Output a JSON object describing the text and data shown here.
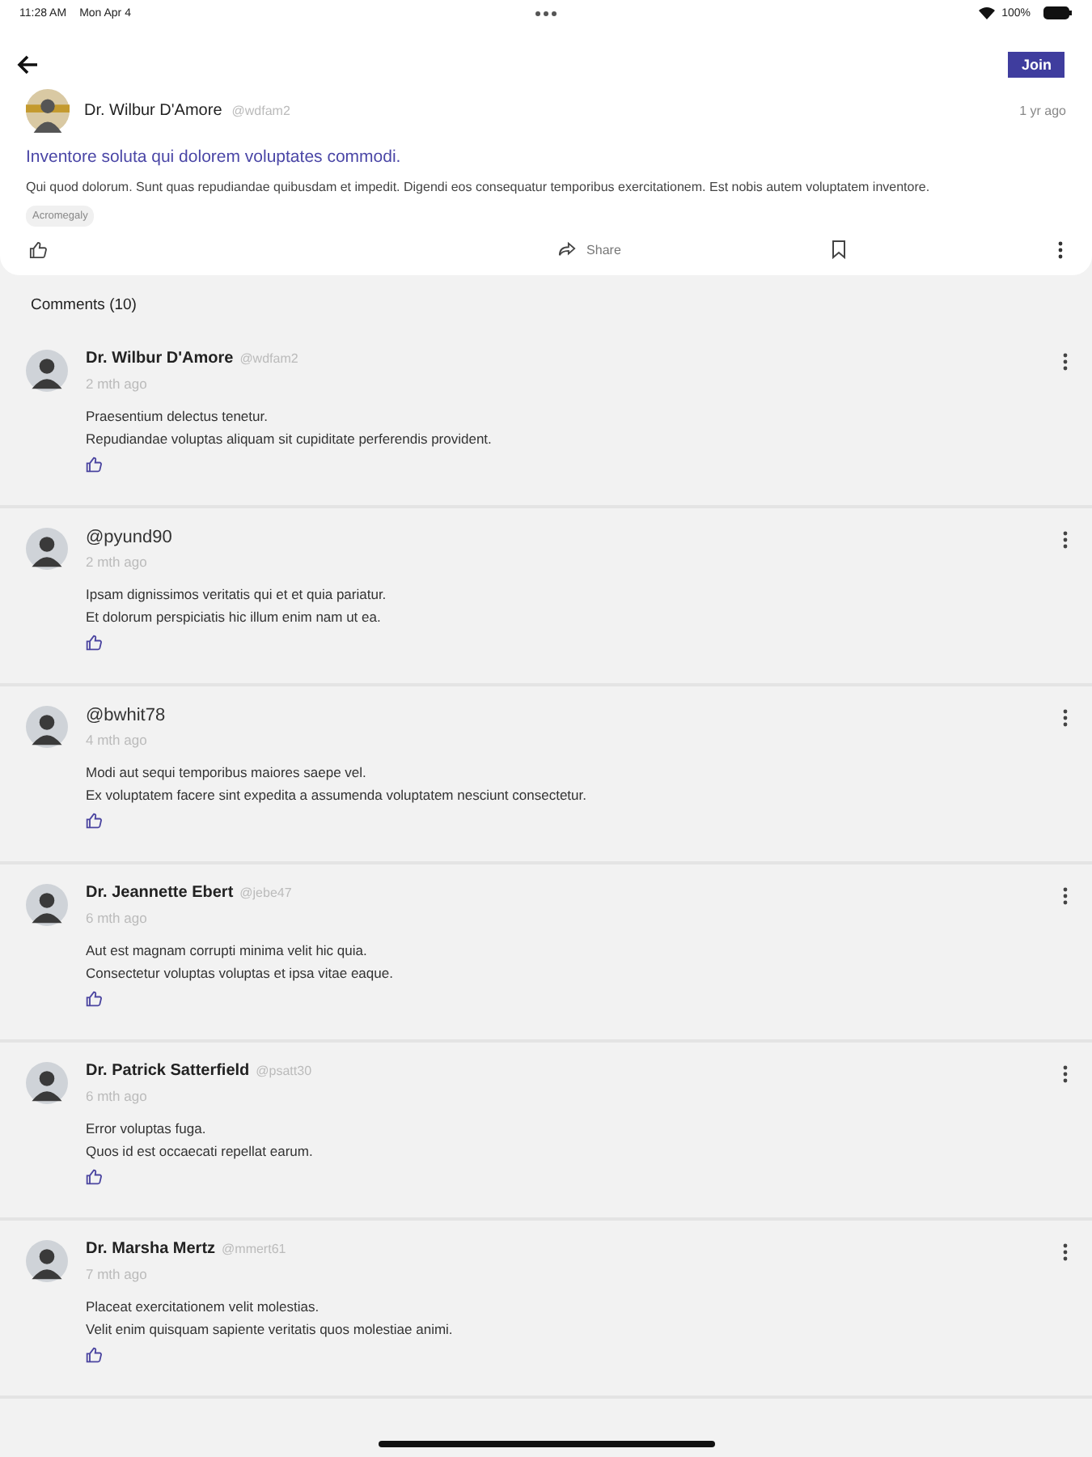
{
  "status_bar": {
    "time": "11:28 AM",
    "date": "Mon Apr 4",
    "battery_text": "100%"
  },
  "header": {
    "join_label": "Join"
  },
  "post": {
    "author": "Dr. Wilbur D'Amore",
    "handle": "@wdfam2",
    "time": "1 yr ago",
    "title": "Inventore soluta qui dolorem voluptates commodi.",
    "body": "Qui quod dolorum. Sunt quas repudiandae quibusdam et impedit. Digendi eos consequatur temporibus exercitationem. Est nobis autem voluptatem inventore.",
    "tag": "Acromegaly",
    "share_label": "Share"
  },
  "comments_heading": "Comments (10)",
  "comments": [
    {
      "kind": "named",
      "name": "Dr. Wilbur D'Amore",
      "handle": "@wdfam2",
      "time": "2 mth ago",
      "lines": [
        "Praesentium delectus tenetur.",
        "Repudiandae voluptas aliquam sit cupiditate perferendis provident."
      ]
    },
    {
      "kind": "handle",
      "handle": "@pyund90",
      "time": "2 mth ago",
      "lines": [
        "Ipsam dignissimos veritatis qui et et quia pariatur.",
        "Et dolorum perspiciatis hic illum enim nam ut ea."
      ]
    },
    {
      "kind": "handle",
      "handle": "@bwhit78",
      "time": "4 mth ago",
      "lines": [
        "Modi aut sequi temporibus maiores saepe vel.",
        "Ex voluptatem facere sint expedita a assumenda voluptatem nesciunt consectetur."
      ]
    },
    {
      "kind": "named",
      "name": "Dr. Jeannette Ebert",
      "handle": "@jebe47",
      "time": "6 mth ago",
      "lines": [
        "Aut est magnam corrupti minima velit hic quia.",
        "Consectetur voluptas voluptas et ipsa vitae eaque."
      ]
    },
    {
      "kind": "named",
      "name": "Dr. Patrick Satterfield",
      "handle": "@psatt30",
      "time": "6 mth ago",
      "lines": [
        "Error voluptas fuga.",
        "Quos id est occaecati repellat earum."
      ]
    },
    {
      "kind": "named",
      "name": "Dr. Marsha Mertz",
      "handle": "@mmert61",
      "time": "7 mth ago",
      "lines": [
        "Placeat exercitationem velit molestias.",
        "Velit enim quisquam sapiente veritatis quos molestiae animi."
      ]
    }
  ]
}
